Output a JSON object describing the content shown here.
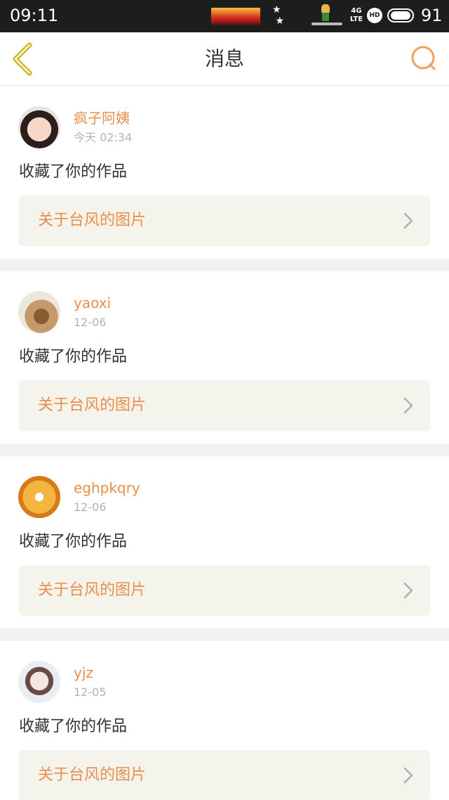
{
  "status_bar": {
    "time": "09:11",
    "network": "4G LTE",
    "hd": "HD",
    "battery": "91"
  },
  "header": {
    "title": "消息",
    "back_icon": "chevron-left-icon",
    "search_icon": "search-icon"
  },
  "colors": {
    "accent": "#e88f4c",
    "back_icon": "#c9b52a",
    "link_bg": "#f4f3ec"
  },
  "messages": [
    {
      "username": "疯子阿姨",
      "time": "今天 02:34",
      "action": "收藏了你的作品",
      "link": "关于台风的图片"
    },
    {
      "username": "yaoxi",
      "time": "12-06",
      "action": "收藏了你的作品",
      "link": "关于台风的图片"
    },
    {
      "username": "eghpkqry",
      "time": "12-06",
      "action": "收藏了你的作品",
      "link": "关于台风的图片"
    },
    {
      "username": "yjz",
      "time": "12-05",
      "action": "收藏了你的作品",
      "link": "关于台风的图片"
    }
  ]
}
